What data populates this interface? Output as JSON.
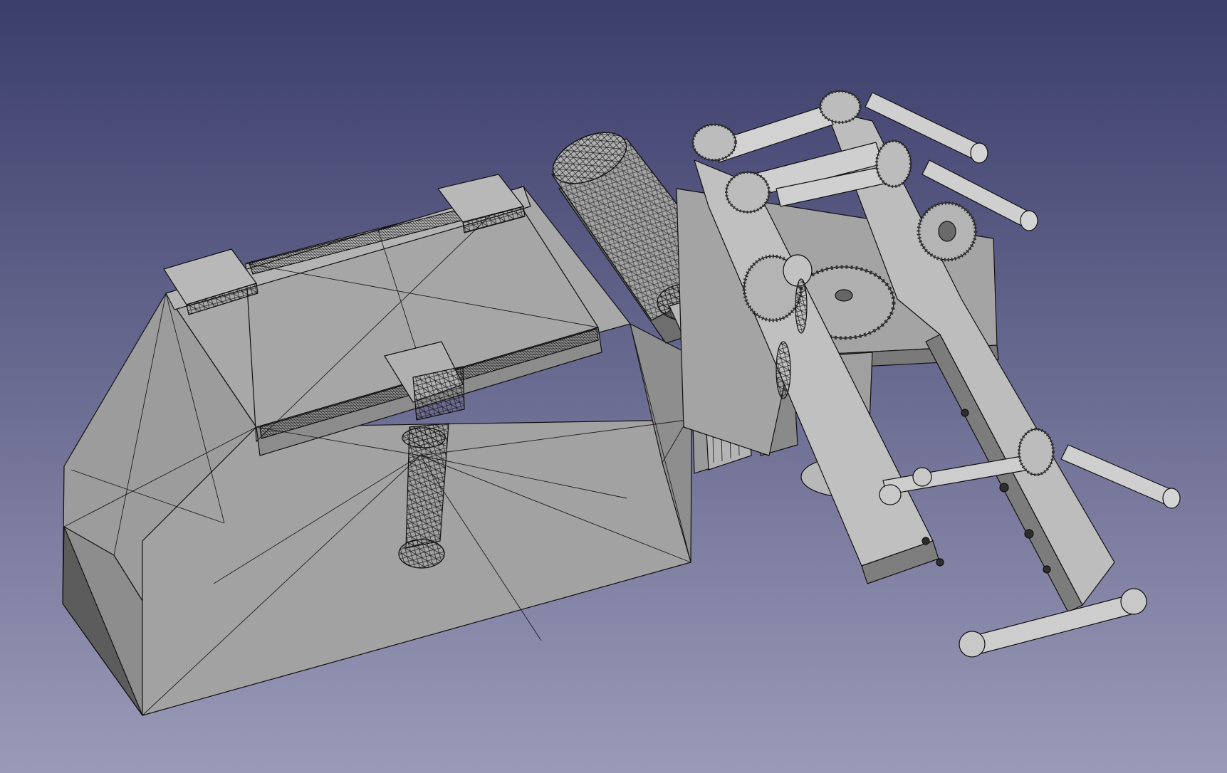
{
  "viewport": {
    "background_top": "#3b3d6b",
    "background_bottom": "#9a9ab8",
    "object_body": "#9a9a9a",
    "object_light": "#c8c8c8",
    "object_mid": "#a8a8a8",
    "object_dark": "#5e5e5e",
    "object_side": "#828282",
    "mesh_edge": "#111111"
  }
}
